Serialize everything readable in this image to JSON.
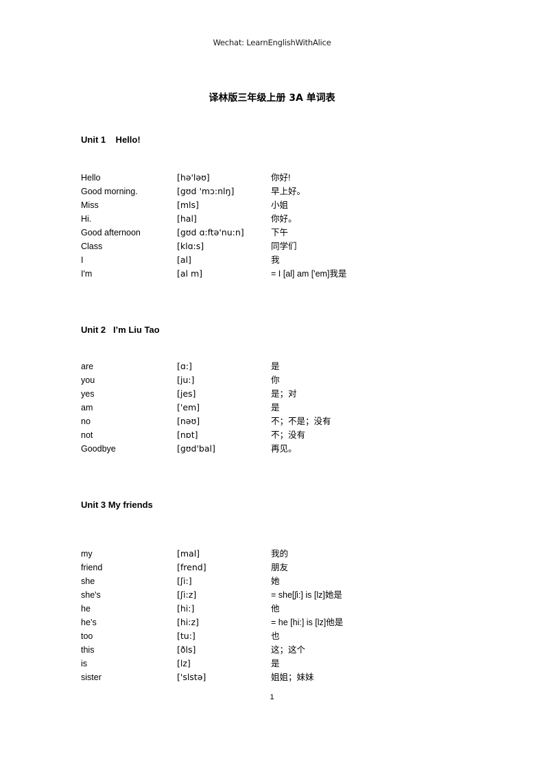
{
  "header": {
    "wechat_line": "Wechat: LearnEnglishWithAlice"
  },
  "title": "译林版三年级上册 3A 单词表",
  "footer": {
    "page_number": "1"
  },
  "units": [
    {
      "heading": "Unit 1    Hello!",
      "rows": [
        {
          "word": "Hello",
          "phonetic": "[hə'ləʊ]",
          "meaning": "你好!"
        },
        {
          "word": "Good morning.",
          "phonetic": "[gʊd 'mɔ:nlŋ]",
          "meaning": "早上好。"
        },
        {
          "word": "Miss",
          "phonetic": "[mls]",
          "meaning": "小姐"
        },
        {
          "word": "Hi.",
          "phonetic": "[hal]",
          "meaning": "你好。"
        },
        {
          "word": "Good afternoon",
          "phonetic": "[gʊd ɑ:ftə'nu:n]",
          "meaning": "下午"
        },
        {
          "word": "Class",
          "phonetic": "[klɑ:s]",
          "meaning": "同学们"
        },
        {
          "word": "I",
          "phonetic": "[al]",
          "meaning": "我"
        },
        {
          "word": "I'm",
          "phonetic": "[al m]",
          "meaning": "= I [al] am ['em]我是"
        }
      ]
    },
    {
      "heading": "Unit 2   I’m Liu Tao",
      "rows": [
        {
          "word": "are",
          "phonetic": "[ɑ:]",
          "meaning": "是"
        },
        {
          "word": "you",
          "phonetic": "[ju:]",
          "meaning": "你"
        },
        {
          "word": "yes",
          "phonetic": "[jes]",
          "meaning": "是；对"
        },
        {
          "word": "am",
          "phonetic": "['em]",
          "meaning": "是"
        },
        {
          "word": "no",
          "phonetic": "[nəʊ]",
          "meaning": "不；不是；没有"
        },
        {
          "word": "not",
          "phonetic": "[nɒt]",
          "meaning": "不；没有"
        },
        {
          "word": "Goodbye",
          "phonetic": "[gʊd'bal]",
          "meaning": "再见。"
        }
      ]
    },
    {
      "heading": "Unit 3 My friends",
      "rows": [
        {
          "word": "my",
          "phonetic": "[mal]",
          "meaning": "我的"
        },
        {
          "word": "friend",
          "phonetic": "[frend]",
          "meaning": "朋友"
        },
        {
          "word": "she",
          "phonetic": "[ʃi:]",
          "meaning": "她"
        },
        {
          "word": "she's",
          "phonetic": "[ʃi:z]",
          "meaning": "= she[ʃi:] is [lz]她是"
        },
        {
          "word": "he",
          "phonetic": "[hi:]",
          "meaning": "他"
        },
        {
          "word": "he’s",
          "phonetic": "[hi:z]",
          "meaning": "= he [hi:] is [lz]他是"
        },
        {
          "word": "too",
          "phonetic": "[tu:]",
          "meaning": "也"
        },
        {
          "word": "this",
          "phonetic": "[ðls]",
          "meaning": "这；这个"
        },
        {
          "word": "is",
          "phonetic": "[lz]",
          "meaning": "是"
        },
        {
          "word": "sister",
          "phonetic": "['slstə]",
          "meaning": "姐姐；妹妹"
        }
      ]
    }
  ]
}
